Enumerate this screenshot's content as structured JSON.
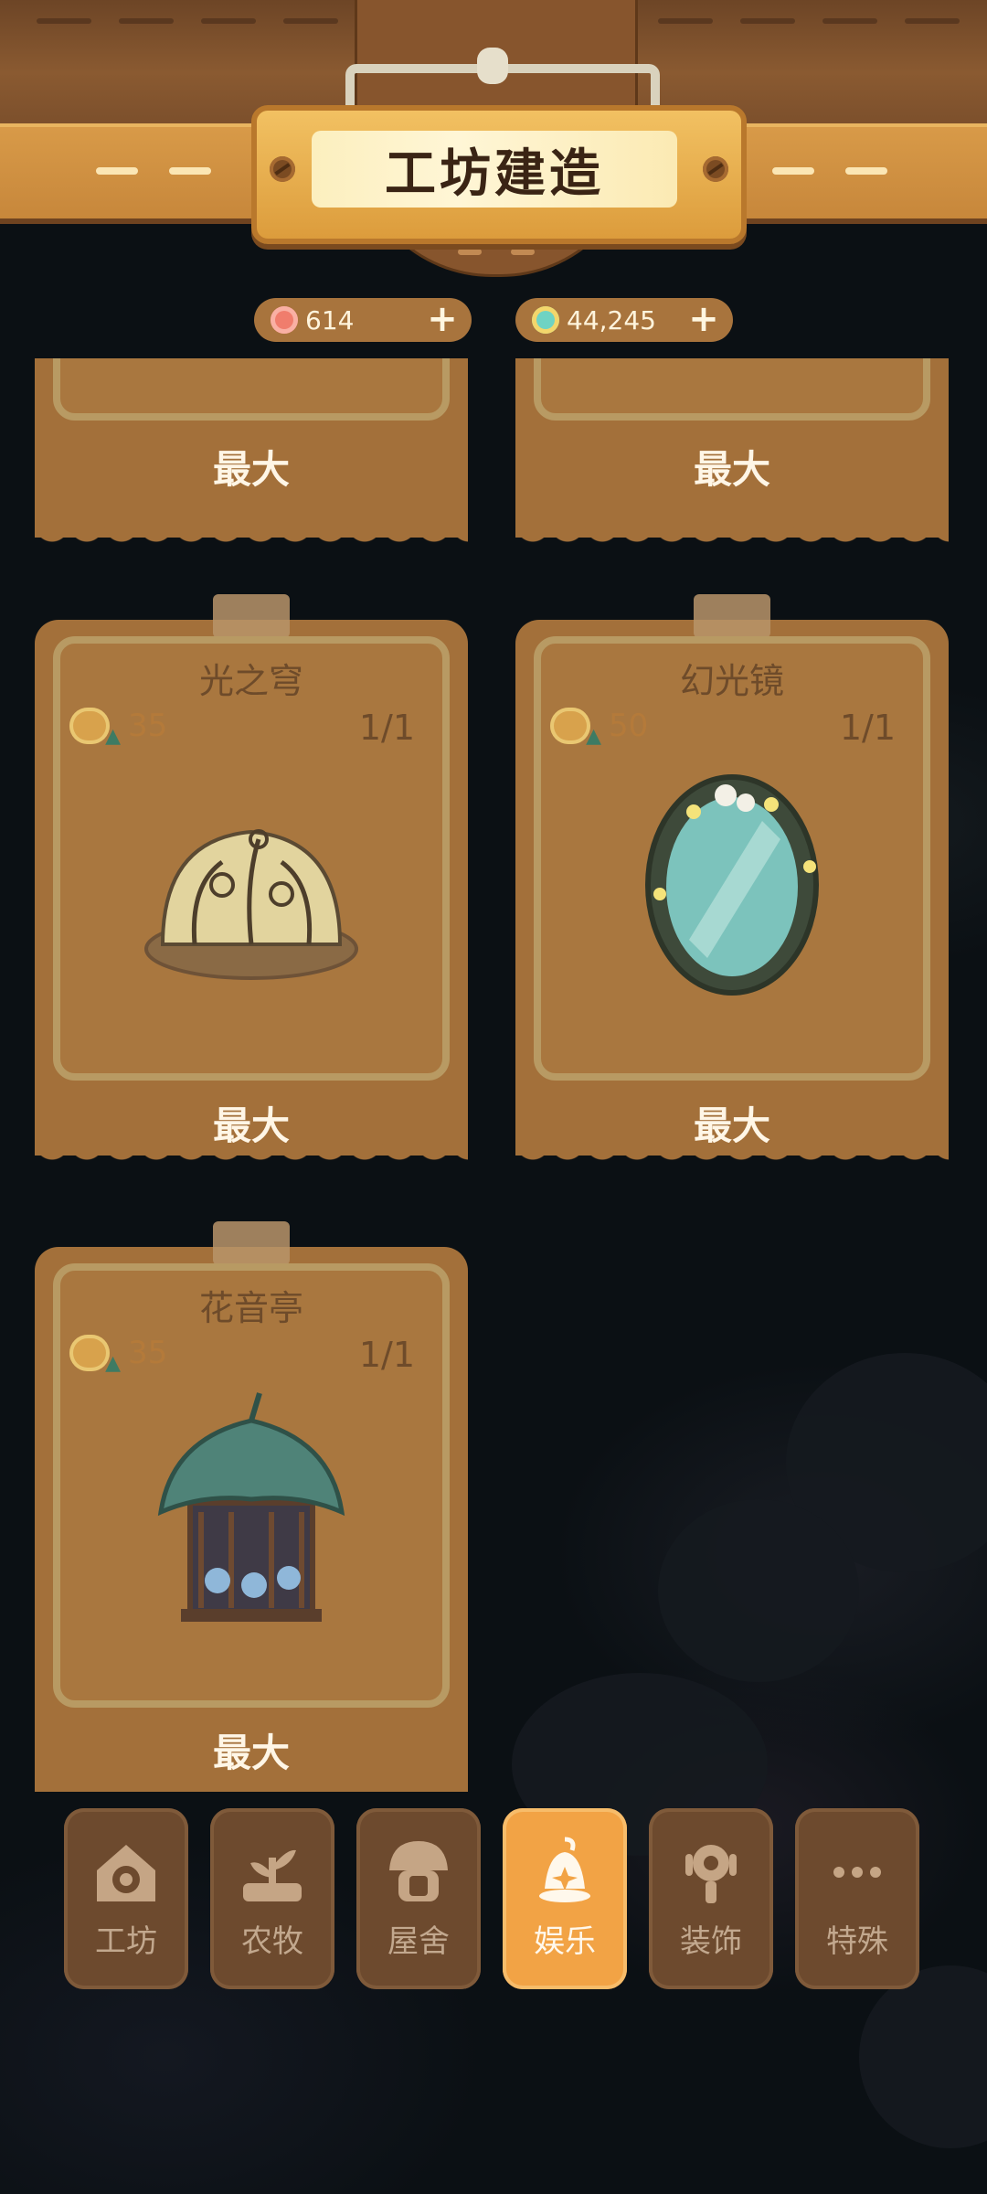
{
  "header": {
    "title": "工坊建造"
  },
  "currencies": [
    {
      "icon": "flower-token-icon",
      "value": "614",
      "color": "#f07d6d"
    },
    {
      "icon": "star-gem-icon",
      "value": "44,245",
      "color": "#6fd3c3"
    }
  ],
  "cards": [
    {
      "name": "",
      "cost": "",
      "count": "",
      "status": "最大"
    },
    {
      "name": "",
      "cost": "",
      "count": "",
      "status": "最大"
    },
    {
      "name": "光之穹",
      "cost": "35",
      "count": "1/1",
      "status": "最大",
      "art": "light-dome-icon"
    },
    {
      "name": "幻光镜",
      "cost": "50",
      "count": "1/1",
      "status": "最大",
      "art": "magic-mirror-icon"
    },
    {
      "name": "花音亭",
      "cost": "35",
      "count": "1/1",
      "status": "最大",
      "art": "flower-pavilion-icon"
    }
  ],
  "nav": [
    {
      "label": "工坊",
      "icon": "gear-house-icon",
      "active": false
    },
    {
      "label": "农牧",
      "icon": "sprout-icon",
      "active": false
    },
    {
      "label": "屋舍",
      "icon": "mushroom-house-icon",
      "active": false
    },
    {
      "label": "娱乐",
      "icon": "bell-lantern-icon",
      "active": true
    },
    {
      "label": "装饰",
      "icon": "lamp-icon",
      "active": false
    },
    {
      "label": "特殊",
      "icon": "more-icon",
      "active": false
    }
  ]
}
